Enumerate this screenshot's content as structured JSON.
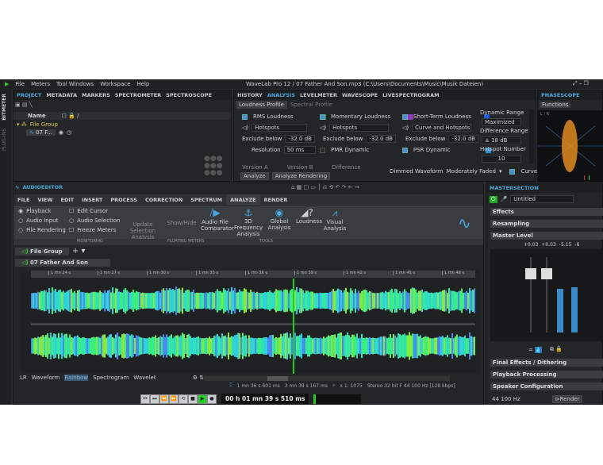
{
  "menu": [
    "File",
    "Meters",
    "Tool Windows",
    "Workspace",
    "Help"
  ],
  "window_title": "WaveLab Pro 12 / 07 Father And Son.mp3 (C:\\Users\\Documents\\Music\\Musik Dateien)",
  "side_strip": [
    "BITMETER",
    "PLUG-INS"
  ],
  "project": {
    "tabs": [
      "PROJECT",
      "METADATA",
      "MARKERS",
      "SPECTROMETER",
      "SPECTROSCOPE"
    ],
    "col_name": "Name",
    "group": "File Group",
    "file": "07 F..."
  },
  "analysis": {
    "tabs": [
      "HISTORY",
      "ANALYSIS",
      "LEVELMETER",
      "WAVESCOPE",
      "LIVESPECTROGRAM"
    ],
    "subtabs": [
      "Loudness Profile",
      "Spectral Profile"
    ],
    "rms": {
      "label": "RMS Loudness",
      "mode": "Hotspots",
      "exclude_label": "Exclude below",
      "exclude": "-32.0 dB",
      "res_label": "Resolution",
      "res": "50 ms",
      "color": "#1a9a2a"
    },
    "momentary": {
      "label": "Momentary Loudness",
      "mode": "Hotspots",
      "exclude_label": "Exclude below",
      "exclude": "-32.0 dB",
      "pmr": "PMR Dynamic",
      "color": "#8a3ab8"
    },
    "short": {
      "label": "Short-Term Loudness",
      "mode": "Curve and Hotspots",
      "exclude_label": "Exclude below",
      "exclude": "-32.0 dB",
      "psr": "PSR Dynamic",
      "color": "#1a5ae0",
      "psr_color": "#2a90d0"
    },
    "dyn_label": "Dynamic Range",
    "dyn": "Maximized",
    "diff_label": "Difference Range",
    "diff": "± 18 dB",
    "hot_label": "Hotspot Number",
    "hot": "10",
    "version_a": "Version A",
    "version_b": "Version B",
    "difference": "Difference",
    "analyze": "Analyze",
    "analyze_rendering": "Analyze Rendering",
    "dimmed_label": "Dimmed Waveform",
    "dimmed": "Moderately Faded",
    "smoothing": "Curve Smoothing"
  },
  "phasescope": {
    "tab": "PHASESCOPE",
    "functions": "Functions",
    "lr": "L / R"
  },
  "editor": {
    "title": "AUDIOEDITOR",
    "ribbon_tabs": [
      "FILE",
      "VIEW",
      "EDIT",
      "INSERT",
      "PROCESS",
      "CORRECTION",
      "SPECTRUM",
      "ANALYZE",
      "RENDER"
    ],
    "monitoring": [
      "Playback",
      "Audio Input",
      "File Rendering"
    ],
    "monitoring2": [
      "Edit Cursor",
      "Audio Selection",
      "Freeze Meters"
    ],
    "update_sel": "Update Selection Analysis",
    "show_hide": "Show/Hide",
    "tools": [
      "Audio File Comparator",
      "3D Frequency Analysis",
      "Global Analysis",
      "Loudness",
      "Visual Analysis"
    ],
    "groups": [
      "MONITORING",
      "FLOATING METERS",
      "TOOLS"
    ],
    "file_group": "File Group",
    "clip": "07 Father And Son",
    "ruler": [
      "1 mn 24 s",
      "1 mn 27 s",
      "1 mn 30 s",
      "1 mn 33 s",
      "1 mn 36 s",
      "1 mn 39 s",
      "1 mn 42 s",
      "1 mn 45 s",
      "1 mn 48 s"
    ],
    "views": [
      "LR",
      "Waveform",
      "Rainbow",
      "Spectrogram",
      "Wavelet"
    ],
    "status": {
      "cursor": "1 mn 36 s 601 ms",
      "length": "3 mn 39 s 167 ms",
      "zoom": "x 1: 1075",
      "format": "Stereo 32 bit F 44 100 Hz [128 kbps]"
    }
  },
  "transport": {
    "time": "00 h 01 mn 39 s 510 ms"
  },
  "master": {
    "title": "MASTERSECTION",
    "preset": "Untitled",
    "effects": "Effects",
    "resampling": "Resampling",
    "level": "Master Level",
    "readout": [
      "+0.03",
      "+0.03",
      "-5.15",
      "-6"
    ],
    "final": "Final Effects / Dithering",
    "playback": "Playback Processing",
    "speaker": "Speaker Configuration",
    "rate": "44 100 Hz",
    "render": "Render",
    "level_fraction": [
      0.58,
      0.6
    ]
  }
}
